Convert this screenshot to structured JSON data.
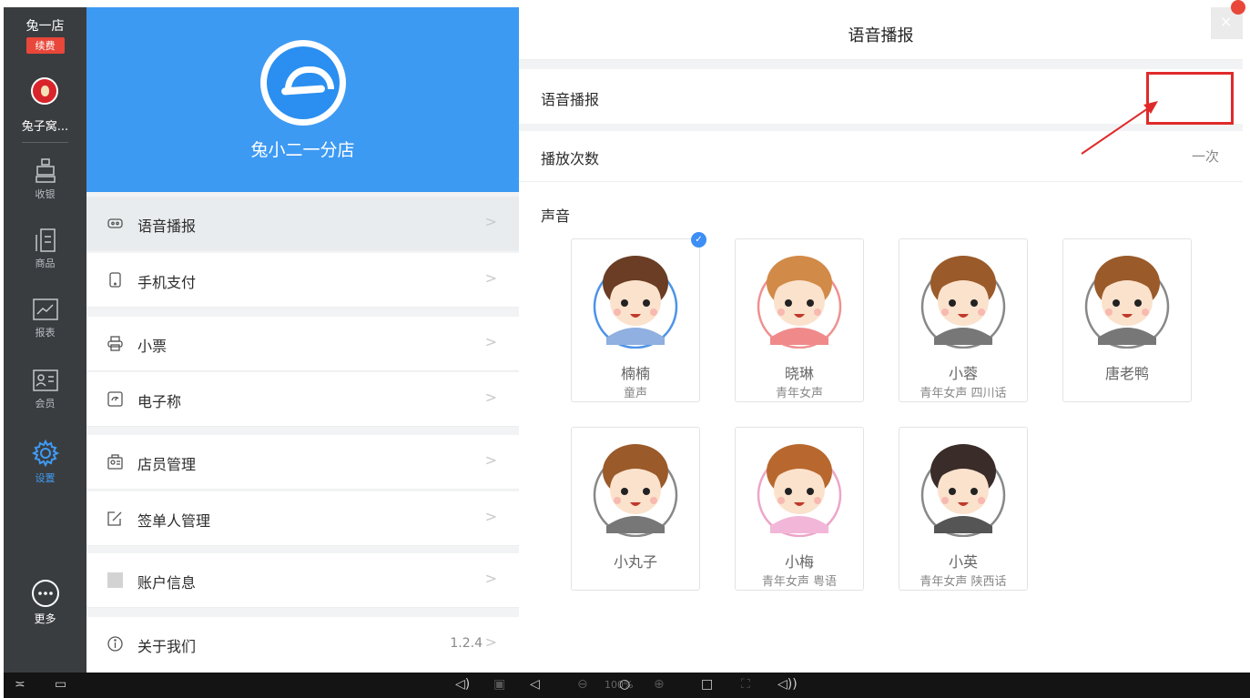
{
  "sidebar": {
    "store_name": "兔一店",
    "renew_label": "续费",
    "shop_name": "兔子窝...",
    "items": [
      {
        "label": "收银",
        "icon": "cashier-icon"
      },
      {
        "label": "商品",
        "icon": "goods-icon"
      },
      {
        "label": "报表",
        "icon": "report-icon"
      },
      {
        "label": "会员",
        "icon": "member-icon"
      },
      {
        "label": "设置",
        "icon": "gear-icon",
        "active": true
      }
    ],
    "more_label": "更多"
  },
  "settings_menu": {
    "store_title": "兔小二一分店",
    "items": [
      {
        "label": "语音播报",
        "icon": "speaker-icon",
        "selected": true
      },
      {
        "label": "手机支付",
        "icon": "phone-icon"
      },
      {
        "label": "小票",
        "icon": "printer-icon"
      },
      {
        "label": "电子称",
        "icon": "scale-icon"
      },
      {
        "label": "店员管理",
        "icon": "staff-icon"
      },
      {
        "label": "签单人管理",
        "icon": "sign-icon"
      },
      {
        "label": "账户信息",
        "icon": "account-icon"
      },
      {
        "label": "关于我们",
        "icon": "info-icon",
        "value": "1.2.4"
      }
    ],
    "chevron": ">"
  },
  "voice_panel": {
    "title": "语音播报",
    "close_label": "×",
    "voice_toggle_label": "语音播报",
    "voice_toggle_on": true,
    "play_count_label": "播放次数",
    "play_count_value": "一次",
    "sound_label": "声音",
    "voices": [
      {
        "name": "楠楠",
        "desc": "童声",
        "selected": true,
        "shirt": "#8fb0e0",
        "hair": "#6a3d24",
        "ring": "#4d93e8"
      },
      {
        "name": "晓琳",
        "desc": "青年女声",
        "selected": false,
        "shirt": "#f08a8a",
        "hair": "#d28a48",
        "ring": "#f09090"
      },
      {
        "name": "小蓉",
        "desc": "青年女声 四川话",
        "selected": false,
        "shirt": "#777",
        "hair": "#9a5a2a",
        "ring": "#888"
      },
      {
        "name": "唐老鸭",
        "desc": "",
        "selected": false,
        "shirt": "#777",
        "hair": "#9a5a2a",
        "ring": "#888"
      },
      {
        "name": "小丸子",
        "desc": "",
        "selected": false,
        "shirt": "#777",
        "hair": "#9a5a2a",
        "ring": "#888"
      },
      {
        "name": "小梅",
        "desc": "青年女声 粤语",
        "selected": false,
        "shirt": "#f2b7d8",
        "hair": "#b8682e",
        "ring": "#eda5c9"
      },
      {
        "name": "小英",
        "desc": "青年女声 陕西话",
        "selected": false,
        "shirt": "#555",
        "hair": "#3a2c28",
        "ring": "#888"
      }
    ]
  },
  "bottom_bar": {
    "zoom_label": "100%"
  },
  "colors": {
    "accent": "#3d9af3",
    "nav_bg": "#3a3d40",
    "toggle_on": "#3d8ef5",
    "annotation_red": "#e02a2a"
  }
}
